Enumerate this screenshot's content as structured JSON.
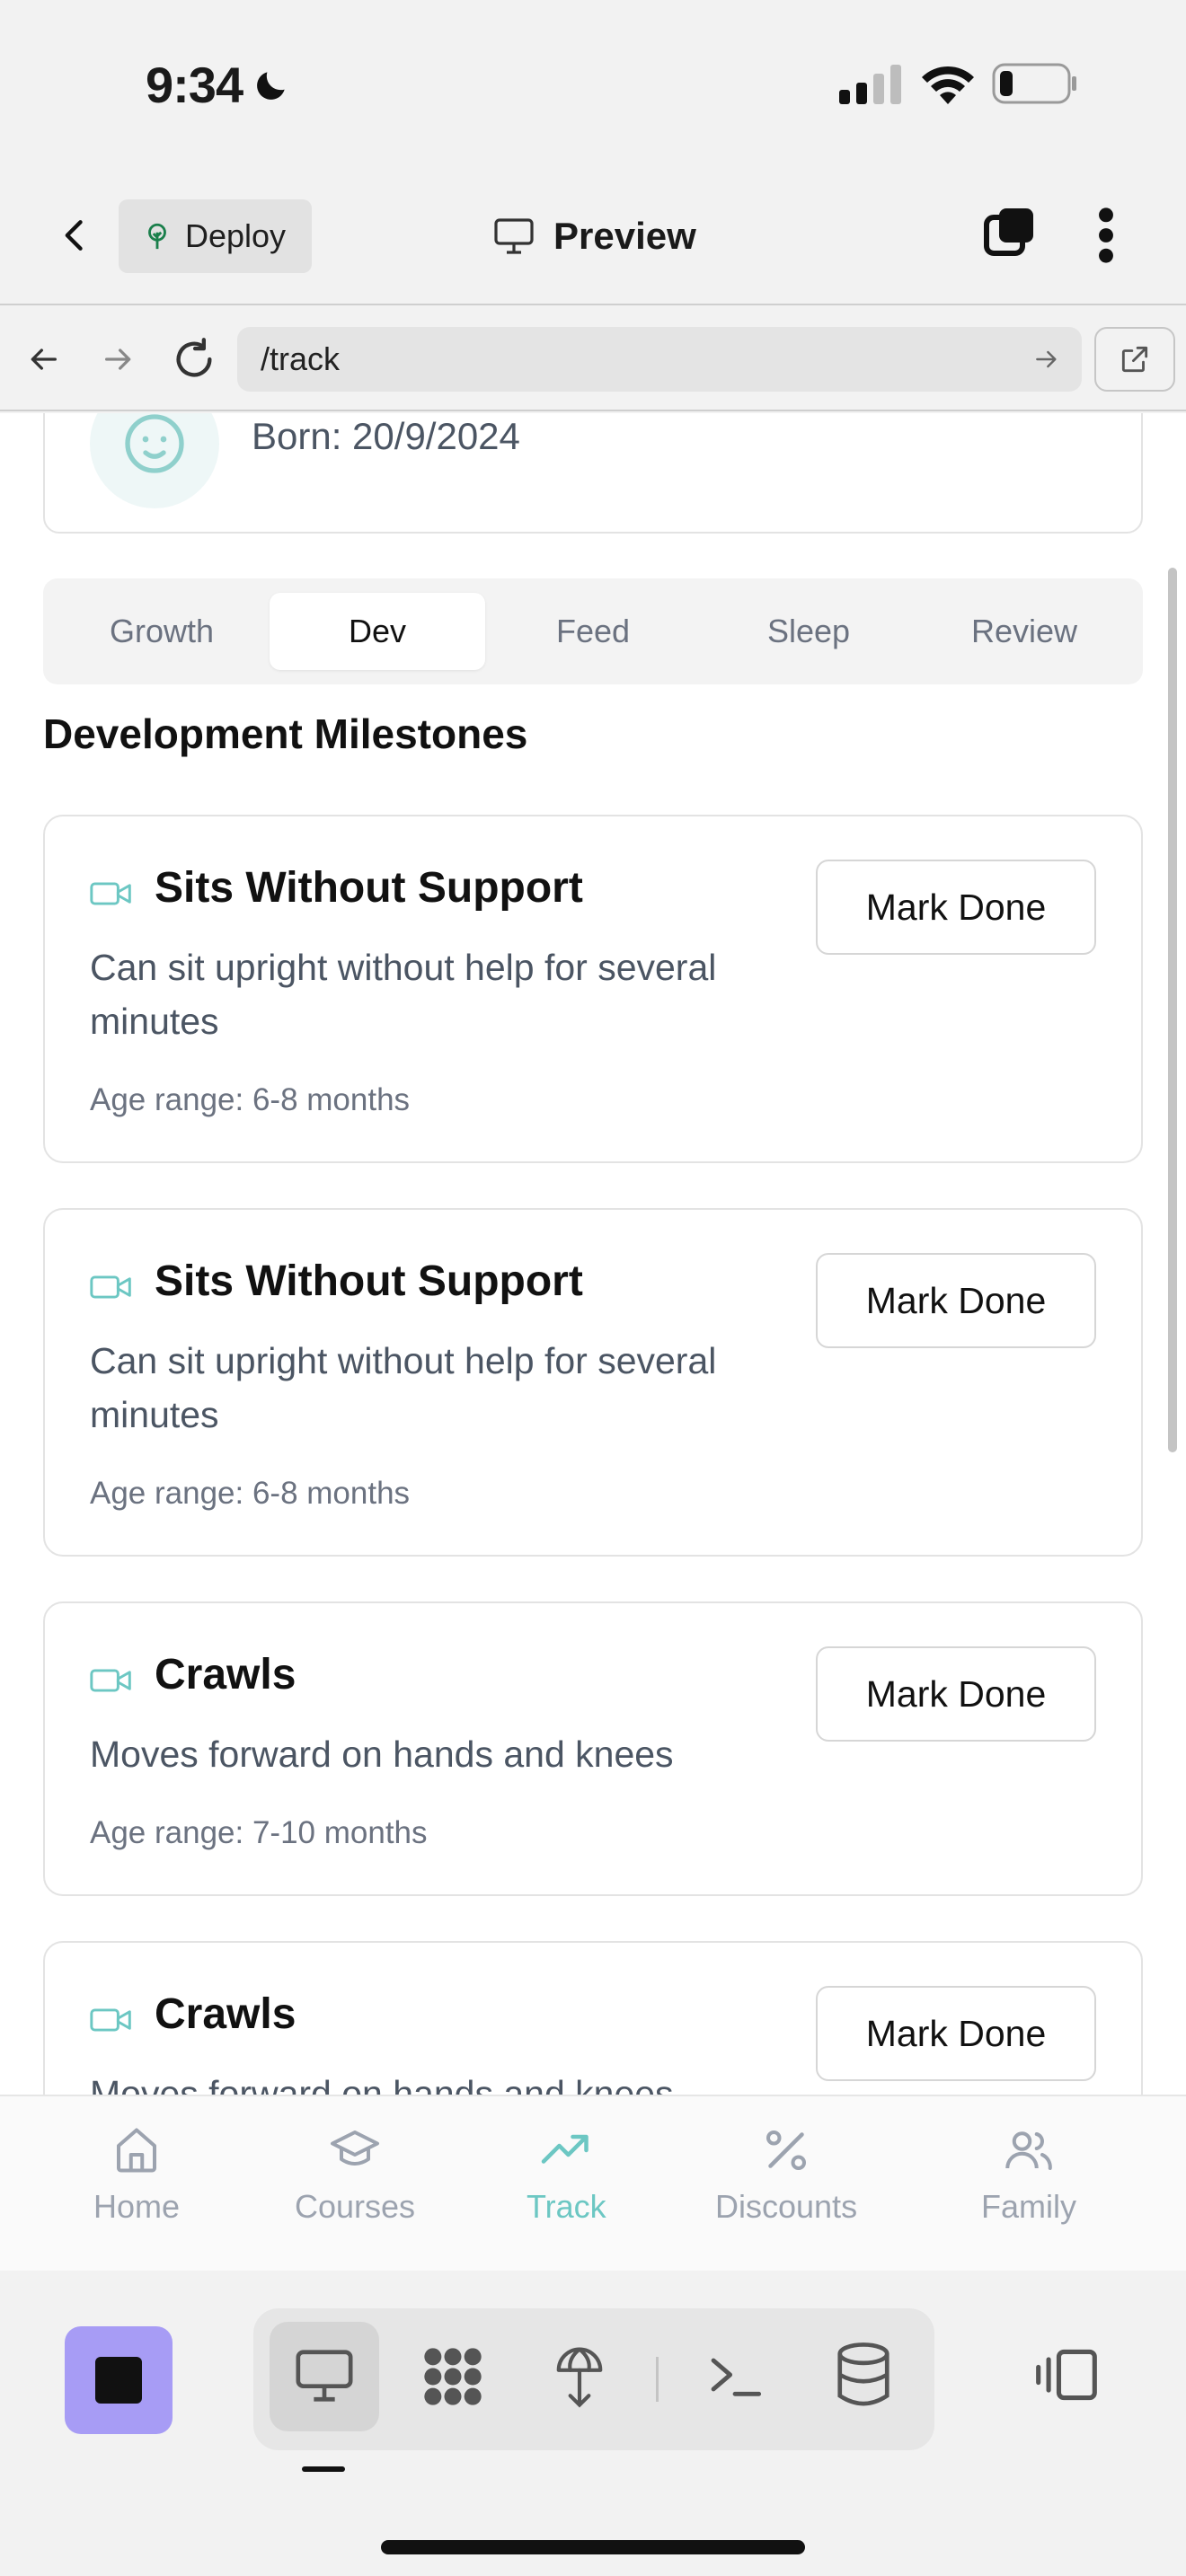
{
  "status": {
    "time": "9:34"
  },
  "header": {
    "deploy_label": "Deploy",
    "preview_label": "Preview"
  },
  "url": {
    "path": "/track"
  },
  "profile": {
    "born": "Born: 20/9/2024"
  },
  "tabs": [
    {
      "label": "Growth",
      "active": false
    },
    {
      "label": "Dev",
      "active": true
    },
    {
      "label": "Feed",
      "active": false
    },
    {
      "label": "Sleep",
      "active": false
    },
    {
      "label": "Review",
      "active": false
    }
  ],
  "section_title": "Development Milestones",
  "milestones": [
    {
      "title": "Sits Without Support",
      "desc": "Can sit upright without help for several minutes",
      "age": "Age range: 6-8 months",
      "button": "Mark Done"
    },
    {
      "title": "Sits Without Support",
      "desc": "Can sit upright without help for several minutes",
      "age": "Age range: 6-8 months",
      "button": "Mark Done"
    },
    {
      "title": "Crawls",
      "desc": "Moves forward on hands and knees",
      "age": "Age range: 7-10 months",
      "button": "Mark Done"
    },
    {
      "title": "Crawls",
      "desc": "Moves forward on hands and knees",
      "age": "",
      "button": "Mark Done"
    }
  ],
  "nav": [
    {
      "label": "Home",
      "icon": "home-icon",
      "active": false
    },
    {
      "label": "Courses",
      "icon": "graduation-cap-icon",
      "active": false
    },
    {
      "label": "Track",
      "icon": "trending-up-icon",
      "active": true
    },
    {
      "label": "Discounts",
      "icon": "percent-icon",
      "active": false
    },
    {
      "label": "Family",
      "icon": "users-icon",
      "active": false
    }
  ],
  "colors": {
    "accent": "#6cc7c3",
    "stop": "#a79cf5"
  }
}
